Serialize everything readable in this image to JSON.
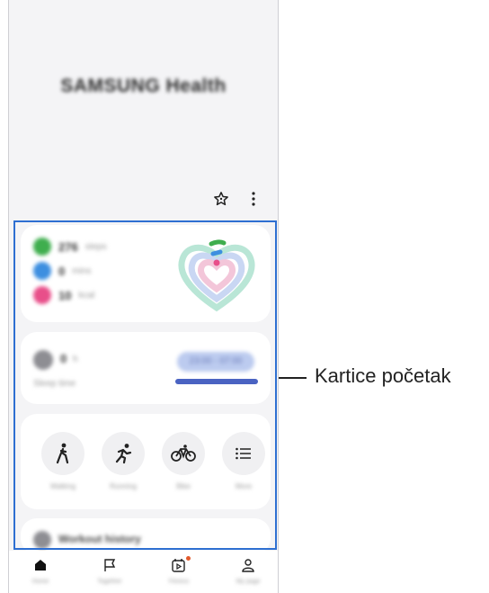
{
  "app": {
    "title": "SAMSUNG Health"
  },
  "cards": {
    "steps": {
      "value": "276",
      "unit": "steps",
      "color": "#3fae4e"
    },
    "minutes": {
      "value": "0",
      "unit": "mins",
      "color": "#3d8fe0"
    },
    "calories": {
      "value": "10",
      "unit": "kcal",
      "color": "#e84f8a"
    },
    "sleep": {
      "value": "0",
      "unit": "h",
      "label": "Sleep time",
      "range": "23:00 - 07:00"
    },
    "activities": [
      {
        "label": "Walking",
        "icon": "walking-icon"
      },
      {
        "label": "Running",
        "icon": "running-icon"
      },
      {
        "label": "Bike",
        "icon": "bike-icon"
      },
      {
        "label": "More",
        "icon": "list-icon"
      }
    ],
    "workout": {
      "title": "Workout history"
    }
  },
  "nav": [
    {
      "label": "Home",
      "icon": "home-icon"
    },
    {
      "label": "Together",
      "icon": "flag-icon"
    },
    {
      "label": "Fitness",
      "icon": "fitness-icon"
    },
    {
      "label": "My page",
      "icon": "person-icon"
    }
  ],
  "callout": {
    "text": "Kartice početak"
  },
  "colors": {
    "highlight": "#2e6fd1",
    "accent": "#4a63c2"
  }
}
